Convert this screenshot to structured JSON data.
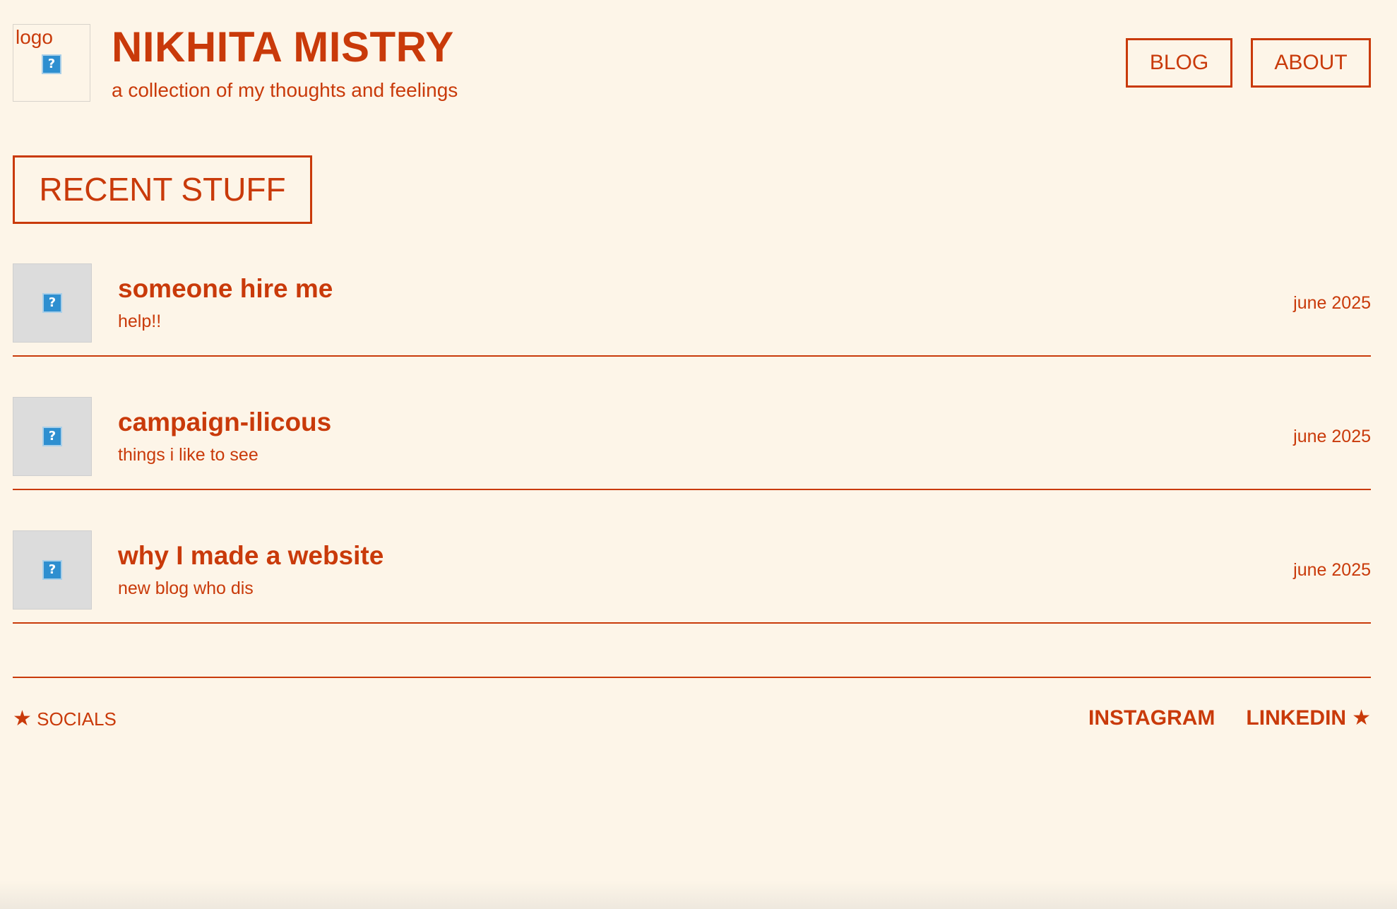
{
  "header": {
    "logo_alt": "logo",
    "title": "NIKHITA MISTRY",
    "tagline": "a collection of my thoughts and feelings",
    "nav": [
      {
        "label": "BLOG"
      },
      {
        "label": "ABOUT"
      }
    ]
  },
  "section": {
    "heading": "RECENT STUFF"
  },
  "posts": [
    {
      "title": "someone hire me",
      "subtitle": "help!!",
      "date": "june 2025"
    },
    {
      "title": "campaign-ilicous",
      "subtitle": "things i like to see",
      "date": "june 2025"
    },
    {
      "title": "why I made a website",
      "subtitle": "new blog who dis",
      "date": "june 2025"
    }
  ],
  "footer": {
    "socials_label": "SOCIALS",
    "star": "★",
    "links": [
      {
        "label": "INSTAGRAM"
      },
      {
        "label": "LINKEDIN"
      }
    ]
  },
  "icons": {
    "broken_image": "?"
  },
  "colors": {
    "accent": "#c93a0a",
    "background": "#fdf5e8",
    "thumbnail_placeholder": "#dcdcdc",
    "broken_image_icon": "#2e8fd0"
  }
}
